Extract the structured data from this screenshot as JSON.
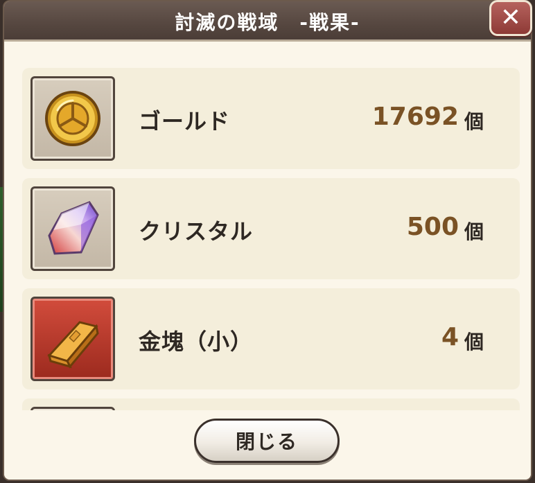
{
  "dialog": {
    "title": "討滅の戦域　-戦果-",
    "close_icon": "close-x-icon"
  },
  "rewards": [
    {
      "name": "ゴールド",
      "quantity": "17692",
      "unit": "個",
      "icon": "gold-coin-icon",
      "frame": "tan"
    },
    {
      "name": "クリスタル",
      "quantity": "500",
      "unit": "個",
      "icon": "crystal-icon",
      "frame": "tan"
    },
    {
      "name": "金塊（小）",
      "quantity": "4",
      "unit": "個",
      "icon": "gold-bar-icon",
      "frame": "red"
    }
  ],
  "footer": {
    "close_label": "閉じる"
  },
  "colors": {
    "title_bar": "#564740",
    "panel": "#fbf6ea",
    "row": "#f4eedb",
    "quantity": "#7a5225",
    "close_button": "#8e3a36"
  }
}
